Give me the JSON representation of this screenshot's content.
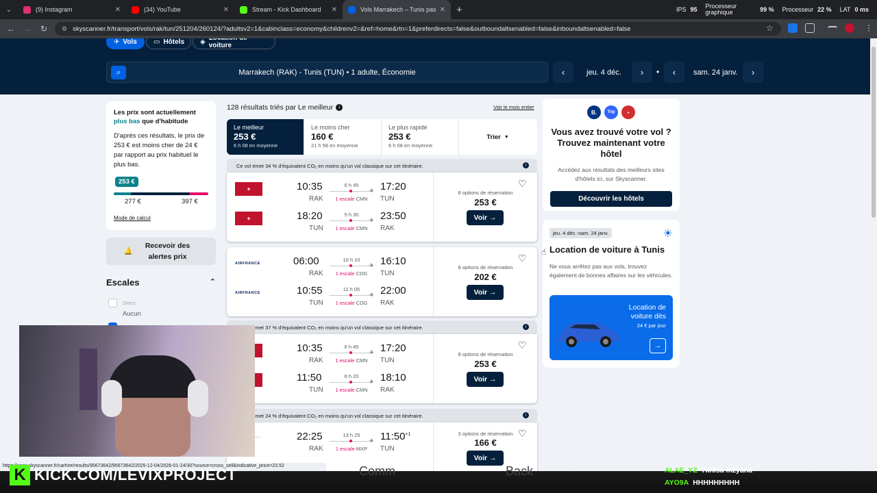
{
  "browser": {
    "tabs": [
      {
        "title": "(9) Instagram",
        "color": "#e1306c"
      },
      {
        "title": "(34) YouTube",
        "color": "#ff0000"
      },
      {
        "title": "Stream - Kick Dashboard",
        "color": "#53fc18"
      },
      {
        "title": "Vols Marrakech – Tunis pas che",
        "color": "#0062e3"
      }
    ],
    "stats": {
      "ips_label": "IPS",
      "ips_value": "95",
      "gpu_label_1": "Processeur",
      "gpu_label_2": "graphique",
      "gpu_value": "99 %",
      "cpu_label": "Processeur",
      "cpu_value": "22 %",
      "lat_label": "LAT",
      "lat_value": "0 ms"
    },
    "url": "skyscanner.fr/transport/vols/rak/tun/251204/260124/?adultsv2=1&cabinclass=economy&childrenv2=&ref=home&rtn=1&preferdirects=false&outboundaltsenabled=false&inboundaltsenabled=false"
  },
  "hero": {
    "pills": [
      "Vols",
      "Hôtels",
      "Location de voiture"
    ],
    "search_text": "Marrakech (RAK) - Tunis (TUN)  •  1 adulte, Économie",
    "depart_date": "jeu. 4 déc.",
    "return_date": "sam. 24 janv."
  },
  "insight": {
    "heading_1": "Les prix sont actuellement ",
    "heading_hl": "plus bas",
    "heading_2": " que d'habitude",
    "body": "D'après ces résultats, le prix de 253 € est moins cher de 24 € par rapport au prix habituel le plus bas.",
    "badge": "253 €",
    "low": "277 €",
    "high": "397 €",
    "mode": "Mode de calcul"
  },
  "alerts_label": "Recevoir des alertes prix",
  "filters": {
    "title": "Escales",
    "direct_label": "Direct",
    "direct_sub": "Aucun"
  },
  "results_header": {
    "count": "128 résultats triés par Le meilleur",
    "month_link": "Voir le mois entier"
  },
  "sort_tabs": [
    {
      "label": "Le meilleur",
      "price": "253 €",
      "duration": "6 h 08 en moyenne"
    },
    {
      "label": "Le moins cher",
      "price": "160 €",
      "duration": "21 h 58 en moyenne"
    },
    {
      "label": "Le plus rapide",
      "price": "253 €",
      "duration": "6 h 08 en moyenne"
    }
  ],
  "sort_button": "Trier",
  "eco_notes": [
    "Ce vol émet 34 % d'équivalent CO₂ en moins qu'un vol classique sur cet itinéraire.",
    "Ce vol émet 37 % d'équivalent CO₂ en moins qu'un vol classique sur cet itinéraire.",
    "Ce vol émet 24 % d'équivalent CO₂ en moins qu'un vol classique sur cet itinéraire."
  ],
  "results": [
    {
      "airline": "Royal Air Maroc",
      "legs": [
        {
          "dep": "10:35",
          "dep_ap": "RAK",
          "arr": "17:20",
          "arr_ap": "TUN",
          "dur": "6 h 45",
          "stop": "1 escale",
          "via": "CMN"
        },
        {
          "dep": "18:20",
          "dep_ap": "TUN",
          "arr": "23:50",
          "arr_ap": "RAK",
          "dur": "5 h 30",
          "stop": "1 escale",
          "via": "CMN"
        }
      ],
      "options": "8 options de réservation",
      "price": "253 €",
      "button": "Voir →"
    },
    {
      "airline": "AIRFRANCE",
      "legs": [
        {
          "dep": "06:00",
          "dep_ap": "RAK",
          "arr": "16:10",
          "arr_ap": "TUN",
          "dur": "10 h 10",
          "stop": "1 escale",
          "via": "CDG"
        },
        {
          "dep": "10:55",
          "dep_ap": "TUN",
          "arr": "22:00",
          "arr_ap": "RAK",
          "dur": "11 h 05",
          "stop": "1 escale",
          "via": "CDG"
        }
      ],
      "options": "8 options de réservation",
      "price": "202 €",
      "button": "Voir →"
    },
    {
      "airline": "Royal Air Maroc",
      "legs": [
        {
          "dep": "10:35",
          "dep_ap": "RAK",
          "arr": "17:20",
          "arr_ap": "TUN",
          "dur": "6 h 45",
          "stop": "1 escale",
          "via": "CMN"
        },
        {
          "dep": "11:50",
          "dep_ap": "TUN",
          "arr": "18:10",
          "arr_ap": "RAK",
          "dur": "6 h 20",
          "stop": "1 escale",
          "via": "CMN"
        }
      ],
      "options": "8 options de réservation",
      "price": "253 €",
      "button": "Voir →"
    },
    {
      "airline": "Malta + …isair",
      "legs": [
        {
          "dep": "22:25",
          "dep_ap": "RAK",
          "arr": "11:50",
          "arr_sup": "+1",
          "arr_ap": "TUN",
          "dur": "13 h 25",
          "stop": "1 escale",
          "via": "MXP"
        }
      ],
      "options": "3 options de réservation",
      "price": "166 €",
      "button": "Voir →"
    }
  ],
  "hotel_card": {
    "brands": [
      "B.",
      "Trip",
      "▪"
    ],
    "title": "Vous avez trouvé votre vol ? Trouvez maintenant votre hôtel",
    "body": "Accédez aux résultats des meilleurs sites d'hôtels ici, sur Skyscanner.",
    "button": "Découvrir les hôtels"
  },
  "car_card": {
    "dates": "jeu. 4 déc.-sam. 24 janv.",
    "title": "Location de voiture à Tunis",
    "body": "Ne vous arrêtez pas aux vols, trouvez également de bonnes affaires sur les véhicules.",
    "banner_title": "Location de voiture dès",
    "banner_price": "24 € par jour"
  },
  "overlay": {
    "status_url": "https://www.skyscanner.fr/carhire/results/95673642/95673642/2025-12-04/2026-01-24/30?source=cross_sell&indicative_price=23.52",
    "kick_text": "KICK.COM/LEVIXPROJECT",
    "ghost_1": "Comm",
    "ghost_2": "Back",
    "chat": [
      {
        "user": "ALAE_YZ",
        "msg": "7khlsa mzyana"
      },
      {
        "user": "AYO9A",
        "msg": "HHHHHHHHH"
      }
    ]
  },
  "colors": {
    "brand": "#0062e3",
    "navy": "#05203c",
    "accent": "#e70866",
    "kick": "#53fc18"
  }
}
